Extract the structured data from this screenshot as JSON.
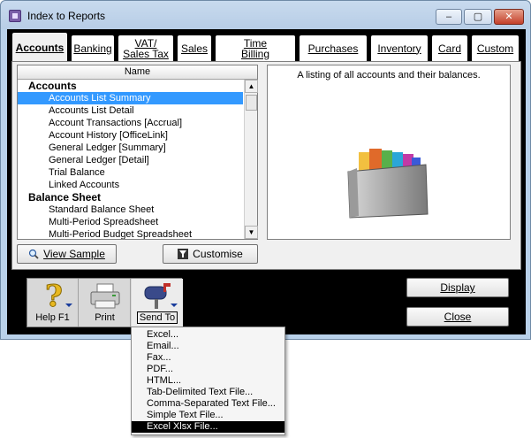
{
  "window": {
    "title": "Index to Reports",
    "min_label": "–",
    "max_label": "▢",
    "close_label": "✕"
  },
  "tabs": [
    {
      "label": "Accounts",
      "active": true
    },
    {
      "label": "Banking"
    },
    {
      "label": "VAT/\nSales Tax"
    },
    {
      "label": "Sales"
    },
    {
      "label": "Time\nBilling"
    },
    {
      "label": "Purchases"
    },
    {
      "label": "Inventory"
    },
    {
      "label": "Card"
    },
    {
      "label": "Custom"
    }
  ],
  "report_list": {
    "header": "Name",
    "rows": [
      {
        "type": "group",
        "label": "Accounts"
      },
      {
        "type": "item",
        "label": "Accounts List Summary",
        "selected": true
      },
      {
        "type": "item",
        "label": "Accounts List Detail"
      },
      {
        "type": "item",
        "label": "Account Transactions [Accrual]"
      },
      {
        "type": "item",
        "label": "Account History [OfficeLink]"
      },
      {
        "type": "item",
        "label": "General Ledger [Summary]"
      },
      {
        "type": "item",
        "label": "General Ledger [Detail]"
      },
      {
        "type": "item",
        "label": "Trial Balance"
      },
      {
        "type": "item",
        "label": "Linked Accounts"
      },
      {
        "type": "group",
        "label": "Balance Sheet"
      },
      {
        "type": "item",
        "label": "Standard Balance Sheet"
      },
      {
        "type": "item",
        "label": "Multi-Period Spreadsheet"
      },
      {
        "type": "item",
        "label": "Multi-Period Budget Spreadsheet"
      }
    ]
  },
  "description": {
    "text": "A listing of all accounts and their balances."
  },
  "buttons": {
    "view_sample": "View Sample",
    "customise": "Customise",
    "display": "Display",
    "close": "Close"
  },
  "toolbar": {
    "help": "Help F1",
    "print": "Print",
    "send_to": "Send To"
  },
  "send_to_menu": {
    "items": [
      "Excel...",
      "Email...",
      "Fax...",
      "PDF...",
      "HTML...",
      "Tab-Delimited Text File...",
      "Comma-Separated Text File...",
      "Simple Text File...",
      "Excel Xlsx File..."
    ],
    "highlighted_index": 8
  },
  "colors": {
    "selection": "#3399ff",
    "client_bg": "#000000",
    "frame": "#b9d1ea"
  }
}
